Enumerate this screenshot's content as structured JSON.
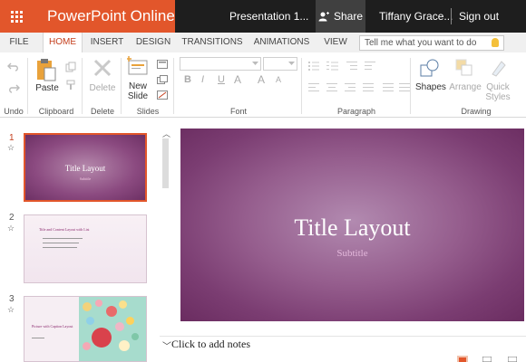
{
  "app": {
    "name": "PowerPoint Online",
    "document_title": "Presentation 1...",
    "share_label": "Share",
    "user_name": "Tiffany Grace...",
    "sign_out_label": "Sign out",
    "accent_color": "#e2562b"
  },
  "tabs": [
    {
      "label": "FILE"
    },
    {
      "label": "HOME",
      "active": true
    },
    {
      "label": "INSERT"
    },
    {
      "label": "DESIGN"
    },
    {
      "label": "TRANSITIONS"
    },
    {
      "label": "ANIMATIONS"
    },
    {
      "label": "VIEW"
    }
  ],
  "tell_me": {
    "placeholder": "Tell me what you want to do"
  },
  "ribbon": {
    "groups": {
      "undo": "Undo",
      "clipboard": "Clipboard",
      "delete": "Delete",
      "slides": "Slides",
      "font": "Font",
      "paragraph": "Paragraph",
      "drawing": "Drawing"
    },
    "buttons": {
      "paste": "Paste",
      "delete": "Delete",
      "new_slide_1": "New",
      "new_slide_2": "Slide",
      "shapes": "Shapes",
      "arrange": "Arrange",
      "quick_styles_1": "Quick",
      "quick_styles_2": "Styles"
    },
    "font_glyphs": {
      "bold": "B",
      "italic": "I",
      "underline": "U",
      "color": "A",
      "grow": "A",
      "shrink": "A"
    }
  },
  "slides": [
    {
      "number": "1",
      "title": "Title Layout",
      "subtitle": "Subtitle",
      "selected": true
    },
    {
      "number": "2",
      "title": "Title and Content Layout with List"
    },
    {
      "number": "3",
      "title": "Picture with Caption Layout"
    }
  ],
  "main_slide": {
    "title": "Title Layout",
    "subtitle": "Subtitle"
  },
  "notes": {
    "placeholder": "Click to add notes"
  },
  "colors": {
    "slide_purple": "#8b4a80",
    "active_tab_text": "#c43e1c"
  }
}
